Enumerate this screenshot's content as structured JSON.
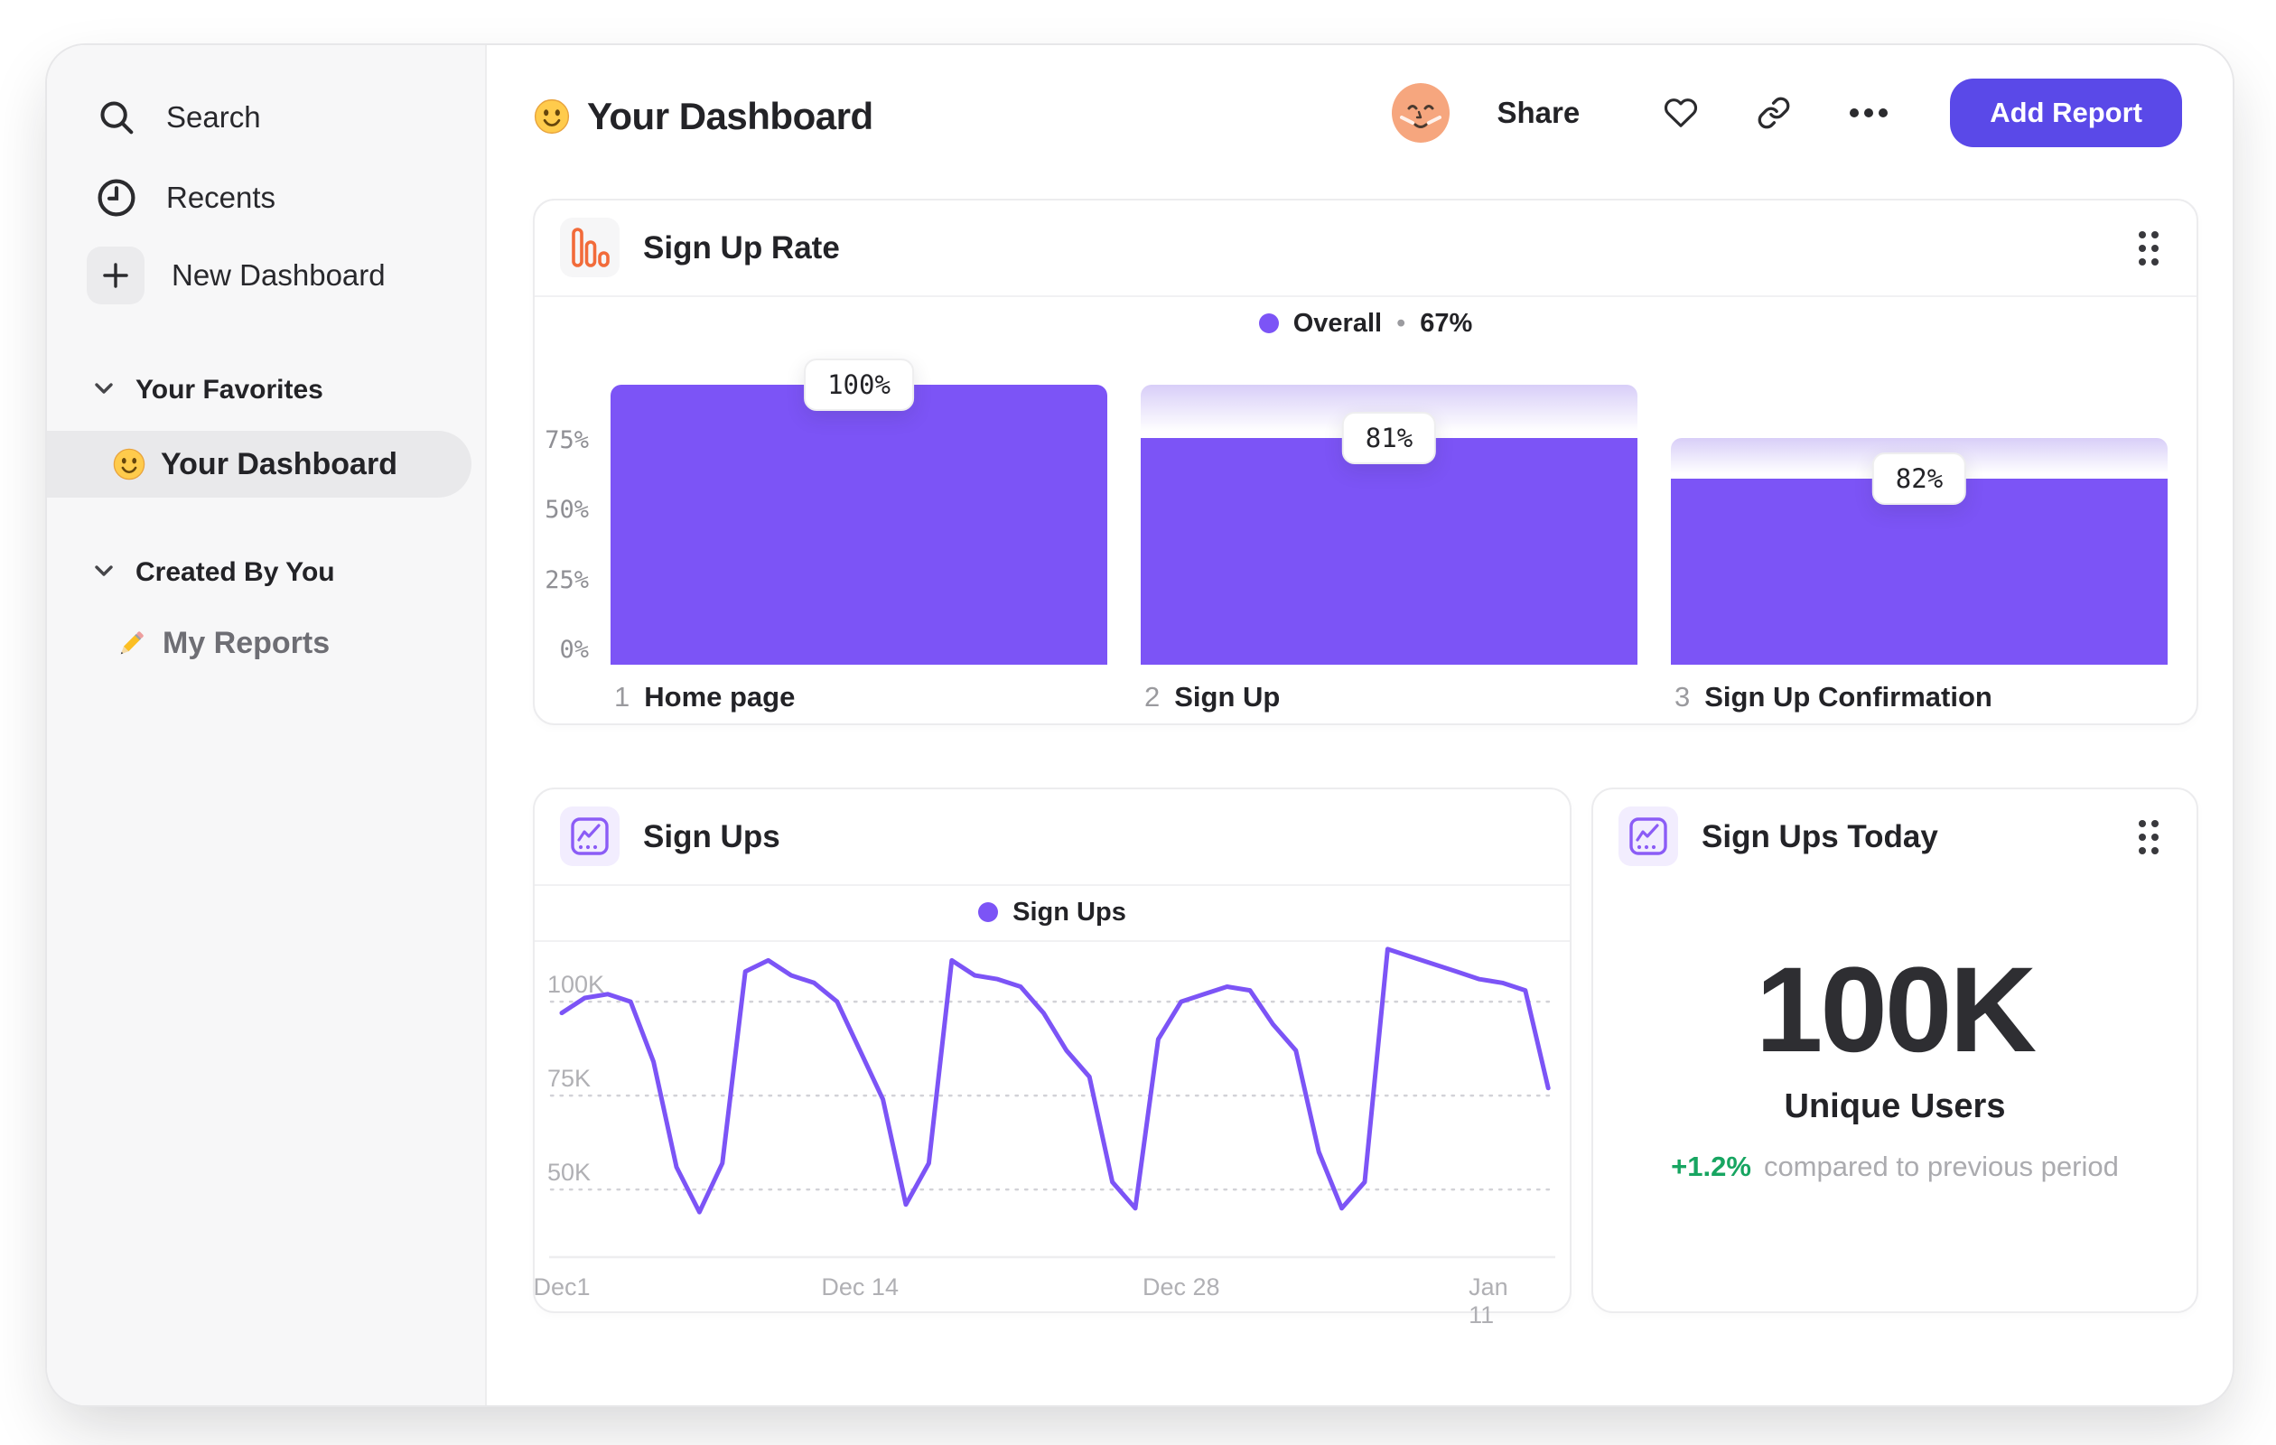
{
  "sidebar": {
    "items": [
      {
        "label": "Search",
        "icon": "search-icon"
      },
      {
        "label": "Recents",
        "icon": "clock-icon"
      },
      {
        "label": "New Dashboard",
        "icon": "plus-icon"
      }
    ],
    "sections": [
      {
        "label": "Your Favorites"
      },
      {
        "label": "Created By You"
      }
    ],
    "favorite_item": {
      "label": "Your Dashboard",
      "icon": "smiley-emoji",
      "selected": true
    },
    "created_item": {
      "label": "My Reports",
      "icon": "pencil-emoji"
    }
  },
  "header": {
    "title": "Your Dashboard",
    "title_icon": "smiley-emoji",
    "share_label": "Share",
    "add_report_label": "Add Report"
  },
  "cards": {
    "funnel": {
      "title": "Sign Up Rate",
      "legend_label": "Overall",
      "legend_sep": "•",
      "legend_value": "67%"
    },
    "line": {
      "title": "Sign Ups",
      "legend_label": "Sign Ups"
    },
    "stat": {
      "title": "Sign Ups Today",
      "value": "100K",
      "unit_label": "Unique Users",
      "delta": "+1.2%",
      "delta_caption": "compared to previous period"
    }
  },
  "chart_data": [
    {
      "type": "bar",
      "title": "Sign Up Rate",
      "legend": "Overall",
      "overall": "67%",
      "categories": [
        "Home page",
        "Sign Up",
        "Sign Up Confirmation"
      ],
      "step_numbers": [
        "1",
        "2",
        "3"
      ],
      "values": [
        100,
        81,
        82
      ],
      "labels": [
        "100%",
        "81%",
        "82%"
      ],
      "cumulative": [
        100,
        81,
        66.4
      ],
      "yticks": [
        "75%",
        "50%",
        "25%",
        "0%"
      ],
      "ytick_values": [
        75,
        50,
        25,
        0
      ],
      "ylim": [
        0,
        100
      ],
      "grid": false,
      "legend_position": "top-center"
    },
    {
      "type": "line",
      "title": "Sign Ups",
      "legend": "Sign Ups",
      "x_ticks": [
        "Dec1",
        "Dec 14",
        "Dec 28",
        "Jan 11"
      ],
      "x_tick_days": [
        0,
        13,
        27,
        41
      ],
      "yticks": [
        "100K",
        "75K",
        "50K"
      ],
      "ytick_values": [
        100,
        75,
        50
      ],
      "ylim_thousands": [
        32,
        116
      ],
      "grid": "dotted-horizontal",
      "values_thousands": [
        97,
        101,
        102,
        100,
        84,
        56,
        44,
        57,
        108,
        111,
        107,
        105,
        100,
        87,
        74,
        46,
        57,
        111,
        107,
        106,
        104,
        97,
        87,
        80,
        52,
        45,
        90,
        100,
        102,
        104,
        103,
        94,
        87,
        60,
        45,
        52,
        114,
        112,
        110,
        108,
        106,
        105,
        103,
        77
      ]
    },
    {
      "type": "stat",
      "title": "Sign Ups Today",
      "value": "100K",
      "label": "Unique Users",
      "delta_pct": "+1.2%",
      "comparison": "compared to previous period"
    }
  ],
  "colors": {
    "accent": "#7C54F6",
    "button": "#5A49E8",
    "funnel_gradient_top": "#D8CEF8",
    "orange_icon": "#F26B3A",
    "purple_icon": "#8B5CF6",
    "green": "#17A561"
  }
}
